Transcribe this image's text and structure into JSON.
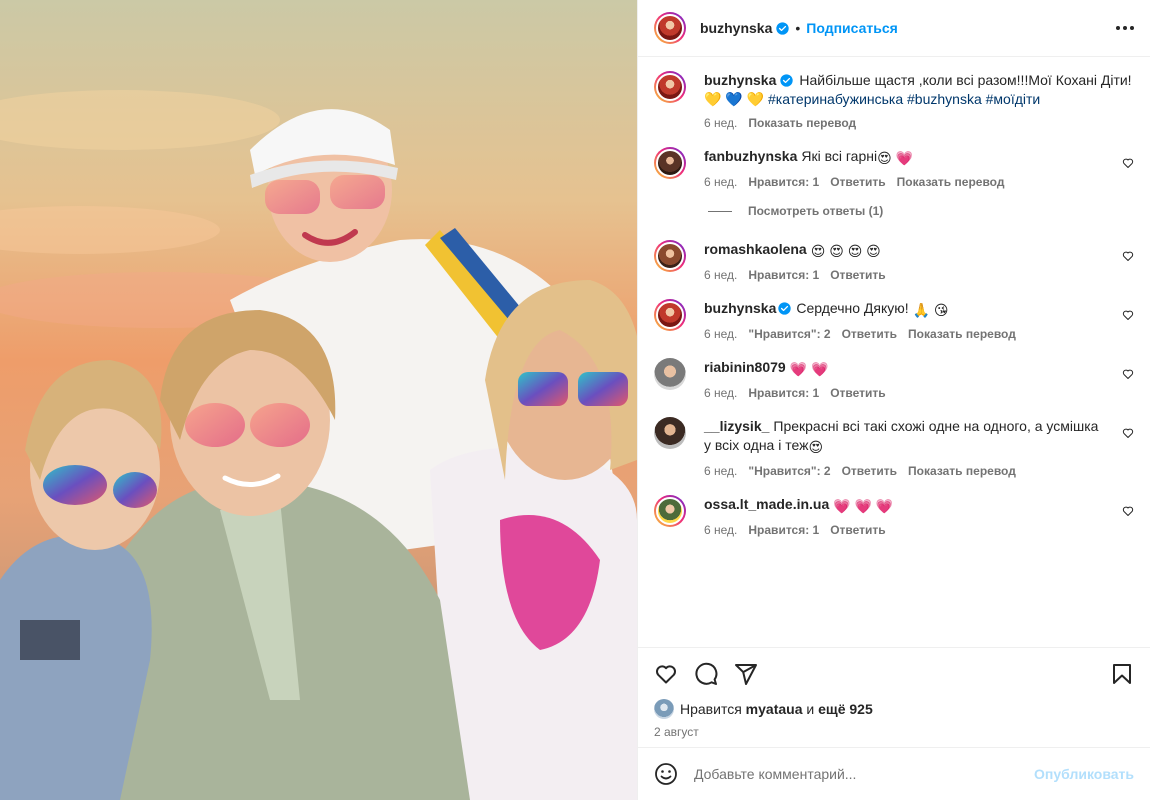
{
  "author": {
    "username": "buzhynska",
    "follow_label": "Подписаться",
    "dot": "•"
  },
  "caption": {
    "username": "buzhynska",
    "text": "Найбільше щастя ,коли всі разом!!!Мої Кохані Діти! ",
    "emoji": "💛 💙 💛",
    "hashtags": "#катеринабужинська #buzhynska #моїдіти",
    "time": "6 нед.",
    "translate": "Показать перевод"
  },
  "comments": [
    {
      "username": "fanbuzhynska",
      "text": "Які всі гарні",
      "emoji": "😍 💗",
      "time": "6 нед.",
      "likes": "Нравится: 1",
      "reply": "Ответить",
      "translate": "Показать перевод",
      "view_replies": "Посмотреть ответы (1)"
    },
    {
      "username": "romashkaolena",
      "text": "",
      "emoji": "😍 😍 😍 😍",
      "time": "6 нед.",
      "likes": "Нравится: 1",
      "reply": "Ответить"
    },
    {
      "username": "buzhynska",
      "text": "Сердечно Дякую!",
      "emoji": "🙏 😘",
      "time": "6 нед.",
      "likes": "\"Нравится\": 2",
      "reply": "Ответить",
      "translate": "Показать перевод"
    },
    {
      "username": "riabinin8079",
      "text": "",
      "emoji": "💗 💗",
      "time": "6 нед.",
      "likes": "Нравится: 1",
      "reply": "Ответить"
    },
    {
      "username": "__lizysik_",
      "text": "Прекрасні всі такі схожі одне на одного, а усмішка у всіх одна і теж",
      "emoji": "😍",
      "time": "6 нед.",
      "likes": "\"Нравится\": 2",
      "reply": "Ответить",
      "translate": "Показать перевод"
    },
    {
      "username": "ossa.lt_made.in.ua",
      "text": "",
      "emoji": "💗 💗 💗",
      "time": "6 нед.",
      "likes": "Нравится: 1",
      "reply": "Ответить"
    }
  ],
  "likes_bar": {
    "prefix": "Нравится",
    "user": "myataua",
    "and": "и",
    "more": "ещё 925"
  },
  "date": "2 август",
  "add_comment": {
    "placeholder": "Добавьте комментарий...",
    "publish": "Опубликовать"
  },
  "colors": {
    "accent": "#0095f6",
    "muted": "#737373",
    "heart": "#ff3b6b"
  }
}
